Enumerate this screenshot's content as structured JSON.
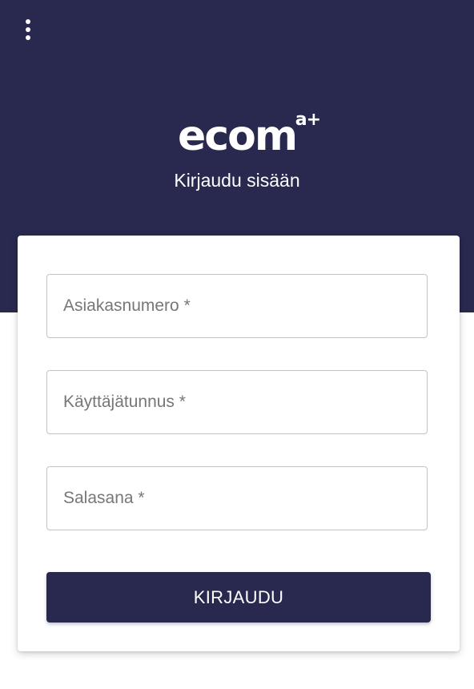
{
  "header": {
    "menu_icon": "more-vert-icon",
    "logo": {
      "text": "ecom",
      "superscript": "a+"
    },
    "subtitle": "Kirjaudu sisään",
    "background_color": "#29284f"
  },
  "form": {
    "customer_number": {
      "placeholder": "Asiakasnumero *",
      "value": ""
    },
    "username": {
      "placeholder": "Käyttäjätunnus *",
      "value": ""
    },
    "password": {
      "placeholder": "Salasana *",
      "value": ""
    },
    "submit_label": "KIRJAUDU",
    "button_color": "#29284f"
  }
}
